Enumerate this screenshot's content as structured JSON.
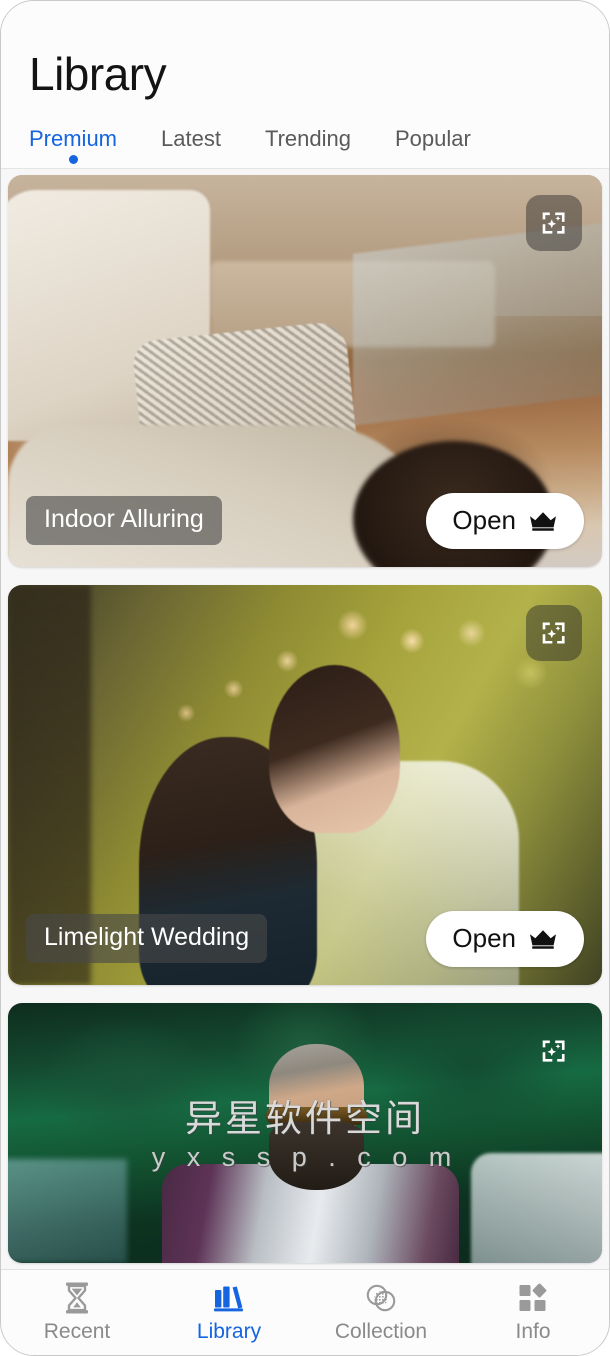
{
  "app": {
    "accent_color": "#1565e0",
    "muted_color": "#8a8a8a"
  },
  "header": {
    "title": "Library",
    "tabs": [
      {
        "label": "Premium",
        "active": true
      },
      {
        "label": "Latest",
        "active": false
      },
      {
        "label": "Trending",
        "active": false
      },
      {
        "label": "Popular",
        "active": false
      }
    ]
  },
  "cards": [
    {
      "title": "Indoor Alluring",
      "open_label": "Open",
      "badge_icon": "auto-enhance-icon",
      "crown_icon": "crown-icon",
      "scene": "indoor-sofa-woman"
    },
    {
      "title": "Limelight Wedding",
      "open_label": "Open",
      "badge_icon": "auto-enhance-icon",
      "crown_icon": "crown-icon",
      "scene": "wedding-couple-bokeh"
    },
    {
      "title": "",
      "open_label": "",
      "badge_icon": "auto-enhance-icon",
      "crown_icon": "crown-icon",
      "scene": "outdoor-bearded-man"
    }
  ],
  "watermark": {
    "line1": "异星软件空间",
    "line2": "y x s s p . c o m"
  },
  "bottom_nav": [
    {
      "label": "Recent",
      "icon": "hourglass-icon",
      "active": false
    },
    {
      "label": "Library",
      "icon": "books-icon",
      "active": true
    },
    {
      "label": "Collection",
      "icon": "overlapping-circles-icon",
      "active": false
    },
    {
      "label": "Info",
      "icon": "shapes-grid-icon",
      "active": false
    }
  ]
}
